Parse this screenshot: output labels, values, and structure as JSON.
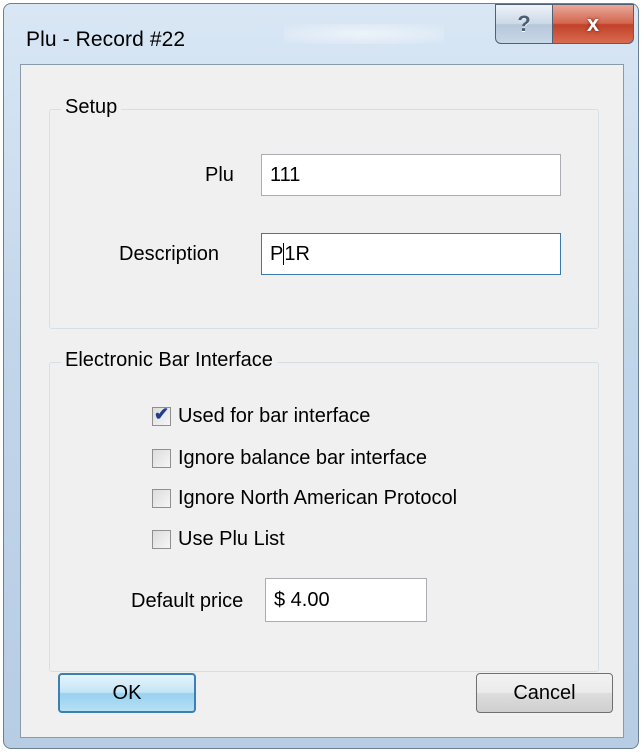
{
  "window": {
    "title": "Plu - Record #22",
    "help_glyph": "?",
    "close_glyph": "x"
  },
  "setup": {
    "group_title": "Setup",
    "plu_label": "Plu",
    "plu_value": "111",
    "description_label": "Description",
    "description_value_before_caret": "P",
    "description_value_after_caret": "1R"
  },
  "ebi": {
    "group_title": "Electronic Bar Interface",
    "checkboxes": [
      {
        "label": "Used for bar interface",
        "checked": true
      },
      {
        "label": "Ignore balance bar interface",
        "checked": false
      },
      {
        "label": "Ignore North American Protocol",
        "checked": false
      },
      {
        "label": "Use Plu List",
        "checked": false
      }
    ],
    "default_price_label": "Default price",
    "default_price_value": "$ 4.00"
  },
  "buttons": {
    "ok": "OK",
    "cancel": "Cancel"
  },
  "colors": {
    "default_button_border": "#3c7fb1",
    "close_button": "#c2412a",
    "check_mark": "#1f3d8a"
  },
  "icons": {
    "check": "✔"
  }
}
